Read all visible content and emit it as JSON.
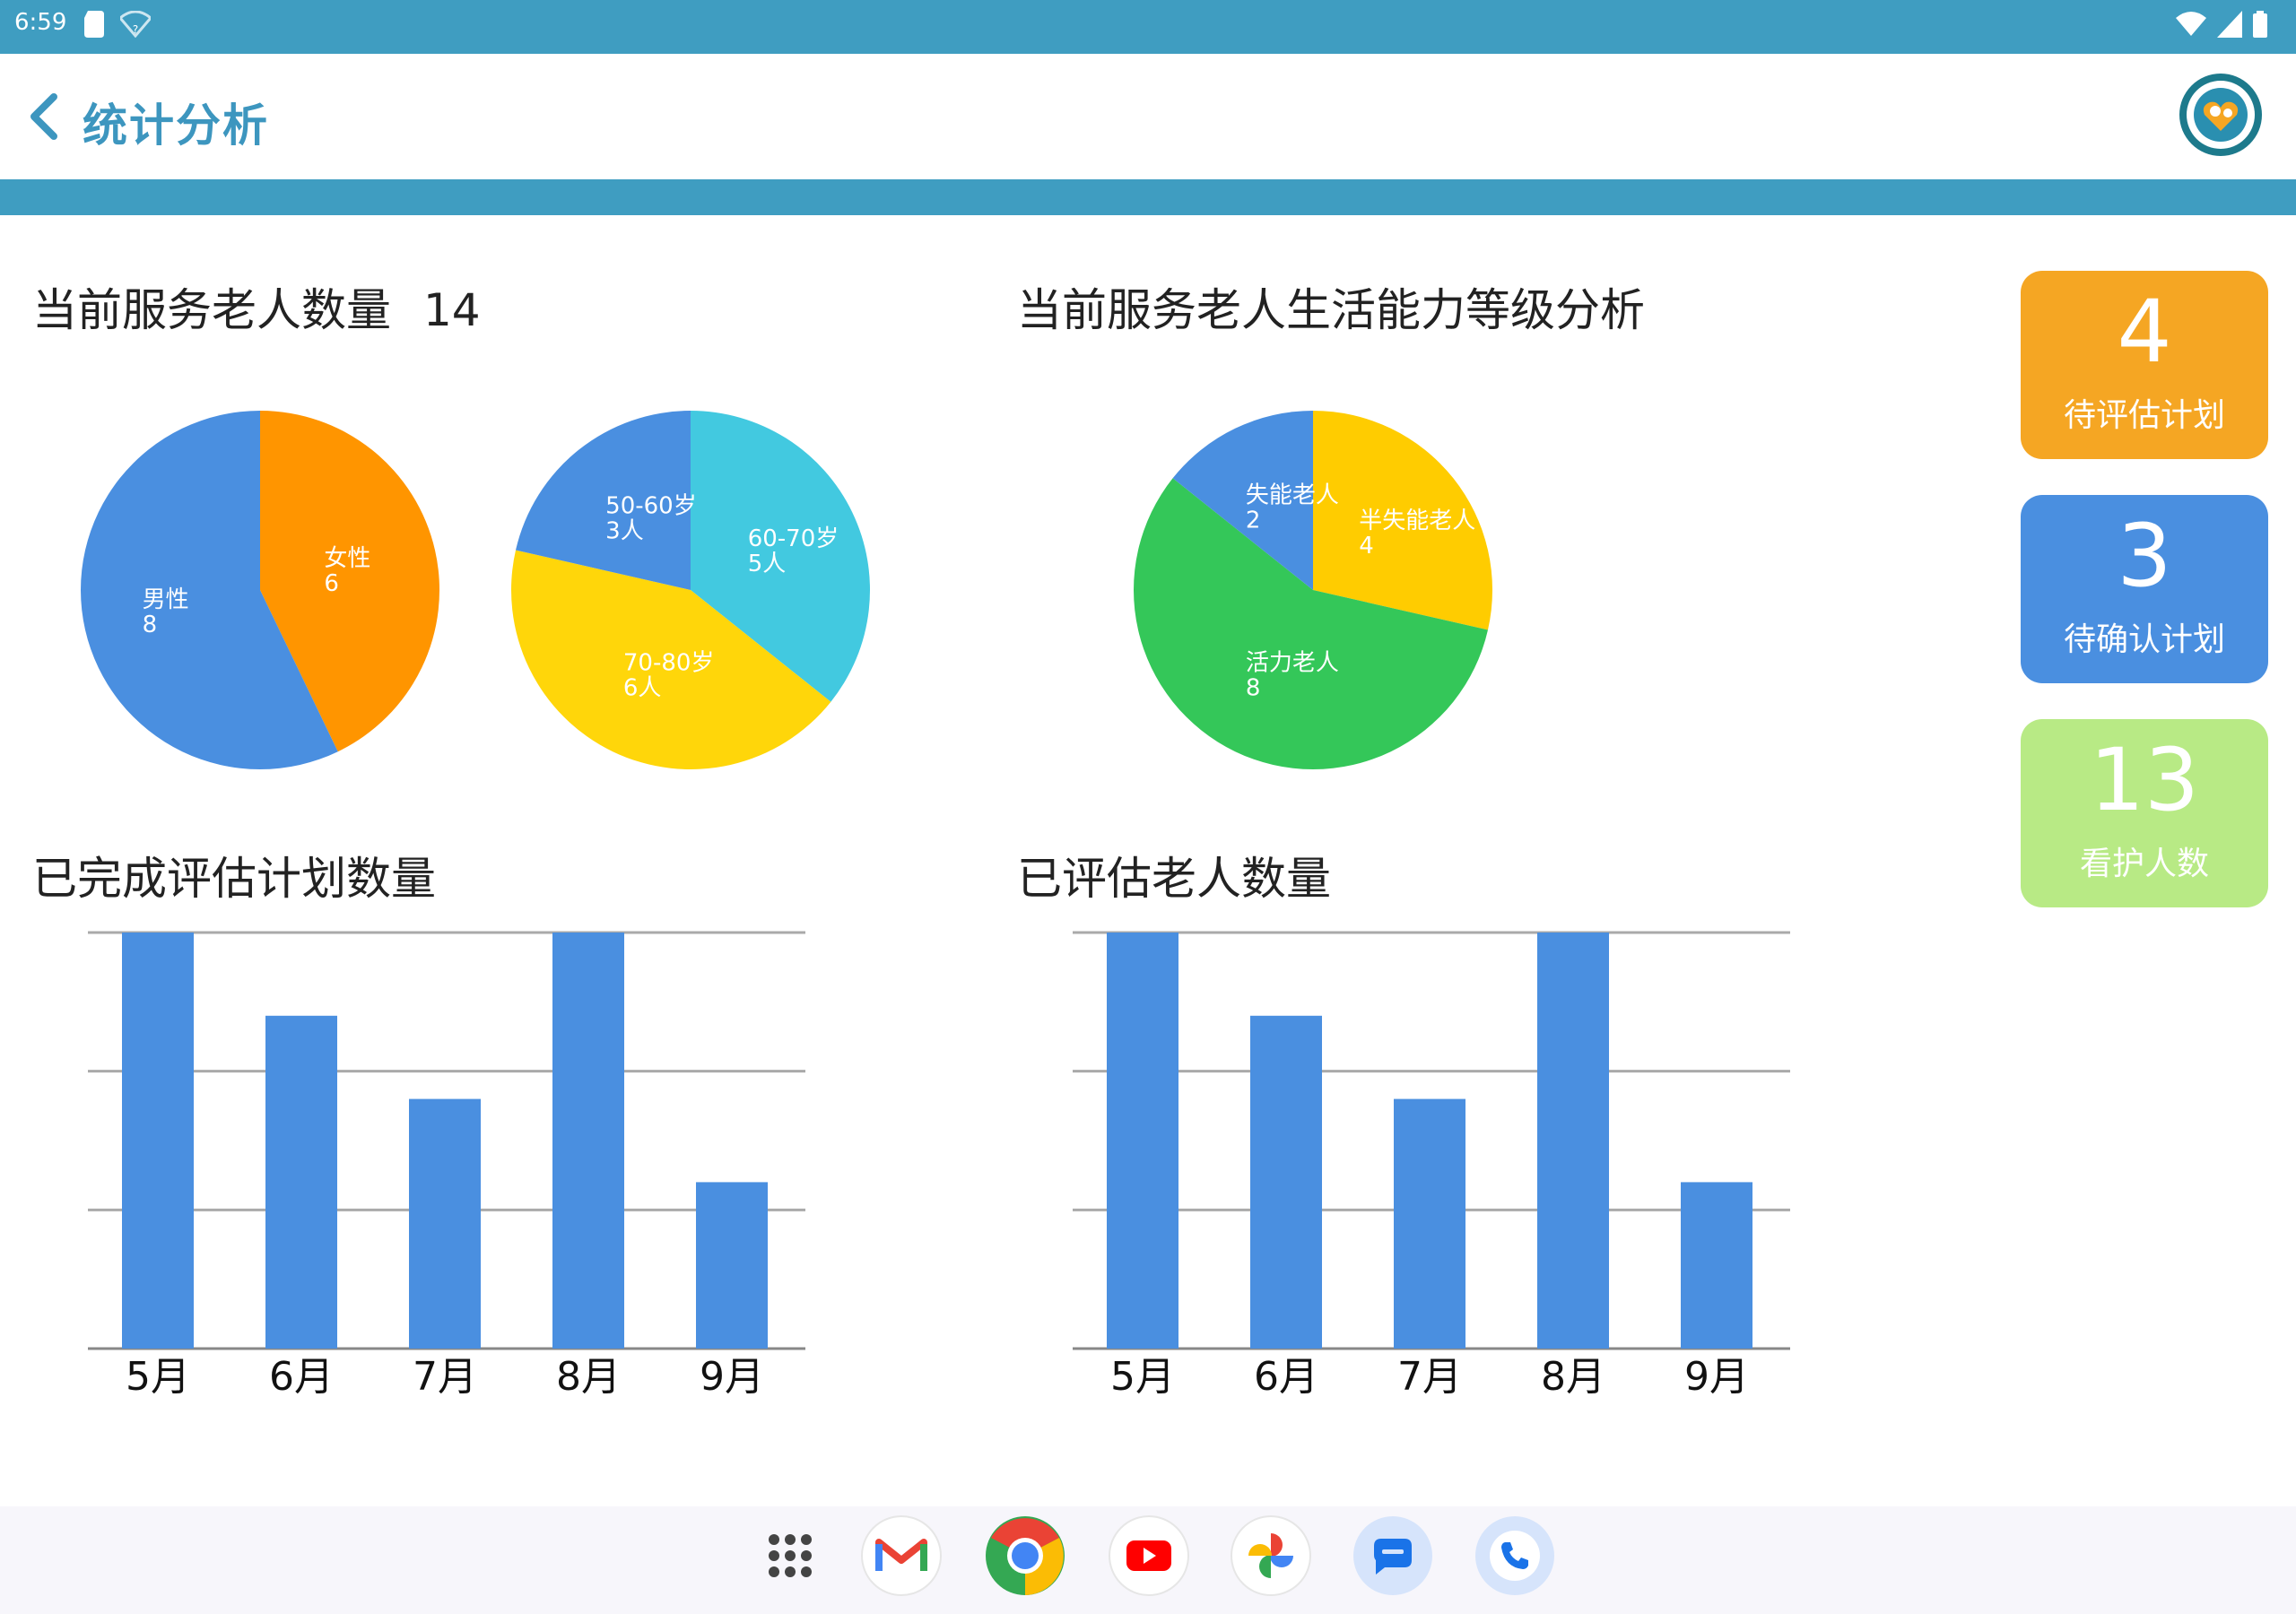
{
  "status_bar": {
    "time": "6:59",
    "left_icons": [
      "sd-card-icon",
      "wifi-question-icon"
    ],
    "right_icons": [
      "wifi-icon",
      "signal-icon",
      "battery-icon"
    ]
  },
  "app_bar": {
    "title": "统计分析",
    "back_icon": "chevron-left-icon",
    "logo": "app-logo"
  },
  "colors": {
    "primary": "#3f9dc1",
    "blue": "#4a8fe0",
    "orange": "#ff9500",
    "cyan": "#42c9e0",
    "yellow": "#ffd60a",
    "green": "#34c759",
    "card_orange": "#f5a623",
    "card_blue": "#4a8fe0",
    "card_green": "#b8ea85"
  },
  "sections": {
    "service_count_title": "当前服务老人数量",
    "service_count_value": "14",
    "ability_title": "当前服务老人生活能力等级分析",
    "completed_plans_title": "已完成评估计划数量",
    "assessed_elders_title": "已评估老人数量"
  },
  "stat_cards": [
    {
      "value": "4",
      "label": "待评估计划",
      "color": "#f5a623"
    },
    {
      "value": "3",
      "label": "待确认计划",
      "color": "#4a8fe0"
    },
    {
      "value": "13",
      "label": "看护人数",
      "color": "#b8ea85"
    }
  ],
  "dock": [
    "app-drawer-icon",
    "gmail-icon",
    "chrome-icon",
    "youtube-icon",
    "photos-icon",
    "messages-icon",
    "phone-icon"
  ],
  "chart_data": [
    {
      "type": "pie",
      "slices": [
        {
          "label": "女性",
          "value": 6,
          "color": "#ff9500"
        },
        {
          "label": "男性",
          "value": 8,
          "color": "#4a8fe0"
        }
      ]
    },
    {
      "type": "pie",
      "slices": [
        {
          "label": "60-70岁",
          "count_label": "5人",
          "value": 5,
          "color": "#42c9e0"
        },
        {
          "label": "70-80岁",
          "count_label": "6人",
          "value": 6,
          "color": "#ffd60a"
        },
        {
          "label": "50-60岁",
          "count_label": "3人",
          "value": 3,
          "color": "#4a8fe0"
        }
      ]
    },
    {
      "type": "pie",
      "slices": [
        {
          "label": "半失能老人",
          "value": 4,
          "color": "#ffcc00"
        },
        {
          "label": "活力老人",
          "value": 8,
          "color": "#34c759"
        },
        {
          "label": "失能老人",
          "value": 2,
          "color": "#4a8fe0"
        }
      ]
    },
    {
      "type": "bar",
      "title": "已完成评估计划数量",
      "categories": [
        "5月",
        "6月",
        "7月",
        "8月",
        "9月"
      ],
      "values": [
        5,
        4,
        3,
        5,
        2
      ],
      "ylim": [
        0,
        5
      ],
      "grid": true,
      "color": "#4a8fe0"
    },
    {
      "type": "bar",
      "title": "已评估老人数量",
      "categories": [
        "5月",
        "6月",
        "7月",
        "8月",
        "9月"
      ],
      "values": [
        5,
        4,
        3,
        5,
        2
      ],
      "ylim": [
        0,
        5
      ],
      "grid": true,
      "color": "#4a8fe0"
    }
  ]
}
